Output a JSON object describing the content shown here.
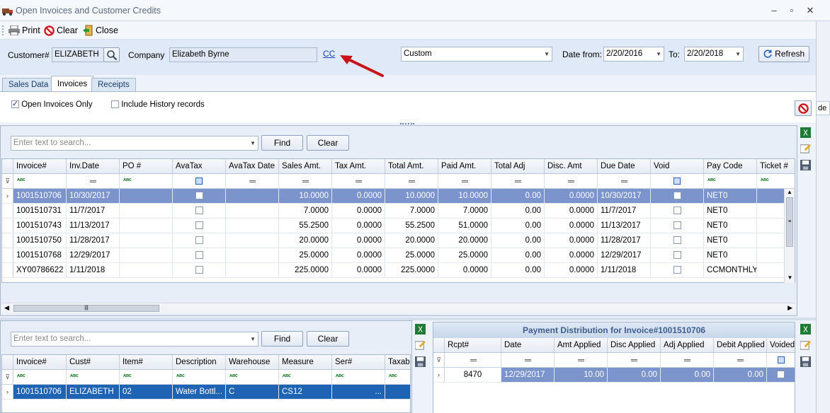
{
  "window": {
    "title": "Open Invoices and Customer Credits"
  },
  "toolbar": {
    "print": "Print",
    "clear": "Clear",
    "close": "Close"
  },
  "criteria": {
    "customer_label": "Customer#",
    "customer_value": "ELIZABETH",
    "company_label": "Company",
    "company_value": "Elizabeth Byrne",
    "cc_link": "CC",
    "range_value": "Custom",
    "date_from_label": "Date from:",
    "date_from_value": "2/20/2016",
    "to_label": "To:",
    "to_value": "2/20/2018",
    "refresh_label": "Refresh",
    "edge_text": "de"
  },
  "tabs": [
    "Sales Data",
    "Invoices",
    "Receipts"
  ],
  "active_tab": "Invoices",
  "options": {
    "open_only": "Open Invoices Only",
    "include_history": "Include History records"
  },
  "top_grid": {
    "search_placeholder": "Enter text to search...",
    "find": "Find",
    "clear": "Clear",
    "columns": [
      "Invoice#",
      "Inv.Date",
      "PO #",
      "AvaTax",
      "AvaTax Date",
      "Sales Amt.",
      "Tax Amt.",
      "Total Amt.",
      "Paid Amt.",
      "Total Adj",
      "Disc. Amt",
      "Due Date",
      "Void",
      "Pay Code",
      "Ticket #"
    ],
    "rows": [
      [
        "1001510706",
        "10/30/2017",
        "",
        "",
        "",
        "10.0000",
        "0.0000",
        "10.0000",
        "10.0000",
        "0.00",
        "0.0000",
        "10/30/2017",
        "",
        "NET0",
        ""
      ],
      [
        "1001510731",
        "11/7/2017",
        "",
        "",
        "",
        "7.0000",
        "0.0000",
        "7.0000",
        "7.0000",
        "0.00",
        "0.0000",
        "11/7/2017",
        "",
        "NET0",
        ""
      ],
      [
        "1001510743",
        "11/13/2017",
        "",
        "",
        "",
        "55.2500",
        "0.0000",
        "55.2500",
        "51.0000",
        "0.00",
        "0.0000",
        "11/13/2017",
        "",
        "NET0",
        ""
      ],
      [
        "1001510750",
        "11/28/2017",
        "",
        "",
        "",
        "20.0000",
        "0.0000",
        "20.0000",
        "20.0000",
        "0.00",
        "0.0000",
        "11/28/2017",
        "",
        "NET0",
        ""
      ],
      [
        "1001510768",
        "12/29/2017",
        "",
        "",
        "",
        "25.0000",
        "0.0000",
        "25.0000",
        "25.0000",
        "0.00",
        "0.0000",
        "12/29/2017",
        "",
        "NET0",
        ""
      ],
      [
        "XY00786622",
        "1/11/2018",
        "",
        "",
        "",
        "225.0000",
        "0.0000",
        "225.0000",
        "0.0000",
        "0.00",
        "0.0000",
        "1/11/2018",
        "",
        "CCMONTHLY",
        ""
      ]
    ]
  },
  "bottom_left": {
    "search_placeholder": "Enter text to search...",
    "find": "Find",
    "clear": "Clear",
    "columns": [
      "Invoice#",
      "Cust#",
      "Item#",
      "Description",
      "Warehouse",
      "Measure",
      "Ser#",
      "Taxabl"
    ],
    "rows": [
      [
        "1001510706",
        "ELIZABETH",
        "02",
        "Water Bottl...",
        "C",
        "CS12",
        "...",
        ""
      ]
    ]
  },
  "payment": {
    "title": "Payment Distribution for Invoice#1001510706",
    "columns": [
      "Rcpt#",
      "Date",
      "Amt Applied",
      "Disc Applied",
      "Adj Applied",
      "Debit Applied",
      "Voided"
    ],
    "rows": [
      [
        "8470",
        "12/29/2017",
        "10.00",
        "0.00",
        "0.00",
        "0.00",
        ""
      ]
    ]
  }
}
